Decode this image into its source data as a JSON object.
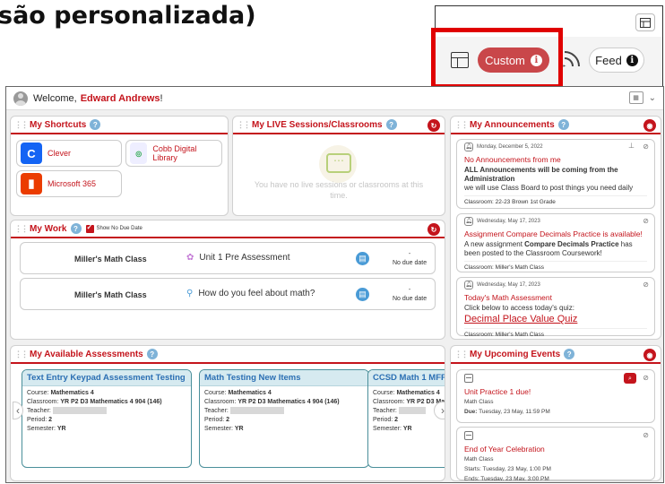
{
  "heading": "são personalizada)",
  "zoom": {
    "custom_label": "Custom",
    "custom_info": "i",
    "feed_label": "Feed",
    "feed_info": "i"
  },
  "welcome": {
    "prefix": "Welcome,",
    "name": "Edward Andrews",
    "suffix": "!"
  },
  "shortcuts": {
    "title": "My Shortcuts",
    "items": [
      {
        "label": "Clever",
        "icon": "clever-logo-icon",
        "color": "#1464f4"
      },
      {
        "label": "Cobb Digital Library",
        "icon": "cobb-library-logo-icon"
      },
      {
        "label": "Microsoft 365",
        "icon": "office-logo-icon",
        "color": "#eb3c00"
      }
    ]
  },
  "live": {
    "title": "My LIVE Sessions/Classrooms",
    "empty_text": "You have no live sessions or classrooms at this time."
  },
  "work": {
    "title": "My Work",
    "show_no_due": "Show No Due Date",
    "rows": [
      {
        "class": "Miller's Math Class",
        "title": "Unit 1 Pre Assessment",
        "due_dash": "-",
        "due": "No due date"
      },
      {
        "class": "Miller's Math Class",
        "title": "How do you feel about math?",
        "due_dash": "-",
        "due": "No due date"
      }
    ]
  },
  "announcements": {
    "title": "My Announcements",
    "items": [
      {
        "date": "Monday, December 5, 2022",
        "title": "No Announcements from me",
        "bold": "ALL Announcements will be coming from the Administration",
        "body": "we will use Class Board to post things you need daily",
        "classroom": "Classroom: 22-23 Brown 1st Grade"
      },
      {
        "date": "Wednesday, May 17, 2023",
        "title": "Assignment Compare Decimals Practice is available!",
        "body_a": "A new assignment ",
        "body_bold": "Compare Decimals Practice",
        "body_b": " has been posted to the Classroom Coursework!",
        "classroom": "Classroom: Miller's Math Class"
      },
      {
        "date": "Wednesday, May 17, 2023",
        "title": "Today's Math Assessment",
        "body": "Click below to access today's quiz:",
        "link": "Decimal Place Value Quiz",
        "classroom": "Classroom: Miller's Math Class"
      }
    ]
  },
  "assessments": {
    "title": "My Available Assessments",
    "cards": [
      {
        "title": "Text Entry Keypad Assessment Testing",
        "course": "Mathematics 4",
        "classroom": "YR P2 D3 Mathematics 4 904 (146)",
        "period": "2",
        "semester": "YR"
      },
      {
        "title": "Math Testing New Items",
        "course": "Mathematics 4",
        "classroom": "YR P2 D3 Mathematics 4 904 (146)",
        "period": "2",
        "semester": "YR"
      },
      {
        "title": "CCSD Math 1 MFF",
        "course": "Mathematics 4",
        "classroom": "YR P2 D3 Ma",
        "period": "2",
        "semester": "YR"
      }
    ],
    "labels": {
      "course": "Course: ",
      "classroom": "Classroom: ",
      "teacher": "Teacher:",
      "period": "Period: ",
      "semester": "Semester: "
    }
  },
  "events": {
    "title": "My Upcoming Events",
    "items": [
      {
        "title": "Unit Practice 1 due!",
        "class": "Math Class",
        "due_label": "Due:",
        "due": "Tuesday, 23 May, 11:59 PM"
      },
      {
        "title": "End of Year Celebration",
        "class": "Math Class",
        "starts": "Starts: Tuesday, 23 May, 1:00 PM",
        "ends": "Ends: Tuesday, 23 May, 3:00 PM"
      }
    ]
  },
  "colors": {
    "accent": "#c4141c",
    "custom_button": "#c9474a",
    "callout_border": "#e00000"
  }
}
